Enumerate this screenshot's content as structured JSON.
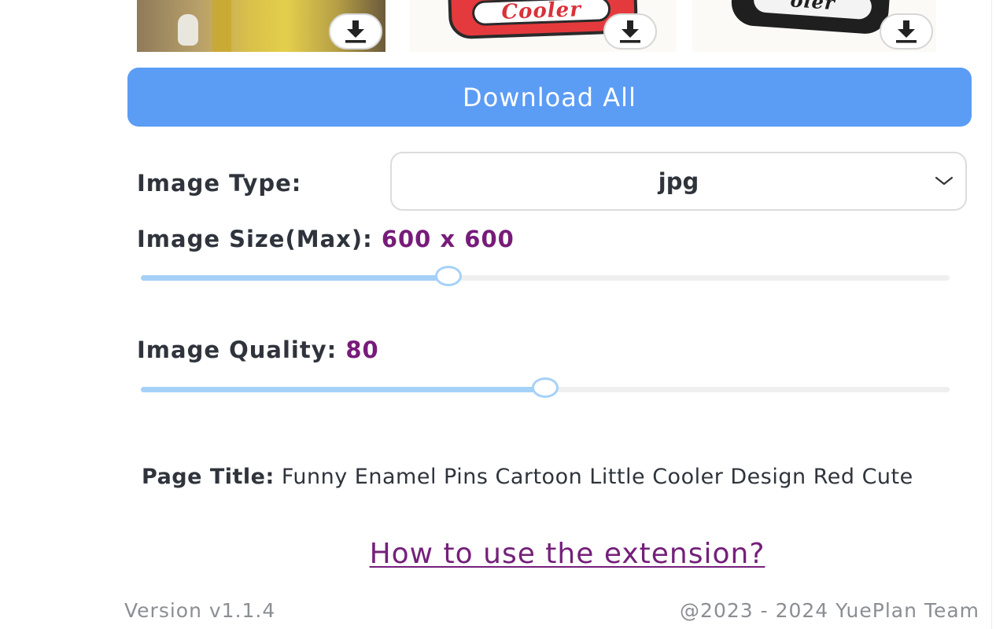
{
  "thumbnails": [
    {
      "alt": "yellow-backpack-photo"
    },
    {
      "alt": "red-cooler-pin",
      "text": "Cooler"
    },
    {
      "alt": "black-cooler-pin",
      "text": "oler"
    }
  ],
  "download_all_label": "Download All",
  "image_type": {
    "label": "Image Type:",
    "value": "jpg"
  },
  "image_size": {
    "label": "Image Size(Max):",
    "value": "600 x 600",
    "slider_fraction": 0.38
  },
  "image_quality": {
    "label": "Image Quality:",
    "value": "80",
    "slider_fraction": 0.5
  },
  "page_title": {
    "label": "Page Title:",
    "value": "Funny Enamel Pins Cartoon Little Cooler Design Red Cute"
  },
  "help_link": "How to use the extension?",
  "footer": {
    "version": "Version v1.1.4",
    "credit": "@2023 - 2024 YuePlan Team"
  },
  "colors": {
    "accent_button": "#5b9cf5",
    "value_accent": "#771b7a",
    "slider": "#a6d1f7",
    "link": "#74207a"
  },
  "icons": {
    "download": "download-arrow-icon",
    "select": "chevron-down-icon"
  }
}
